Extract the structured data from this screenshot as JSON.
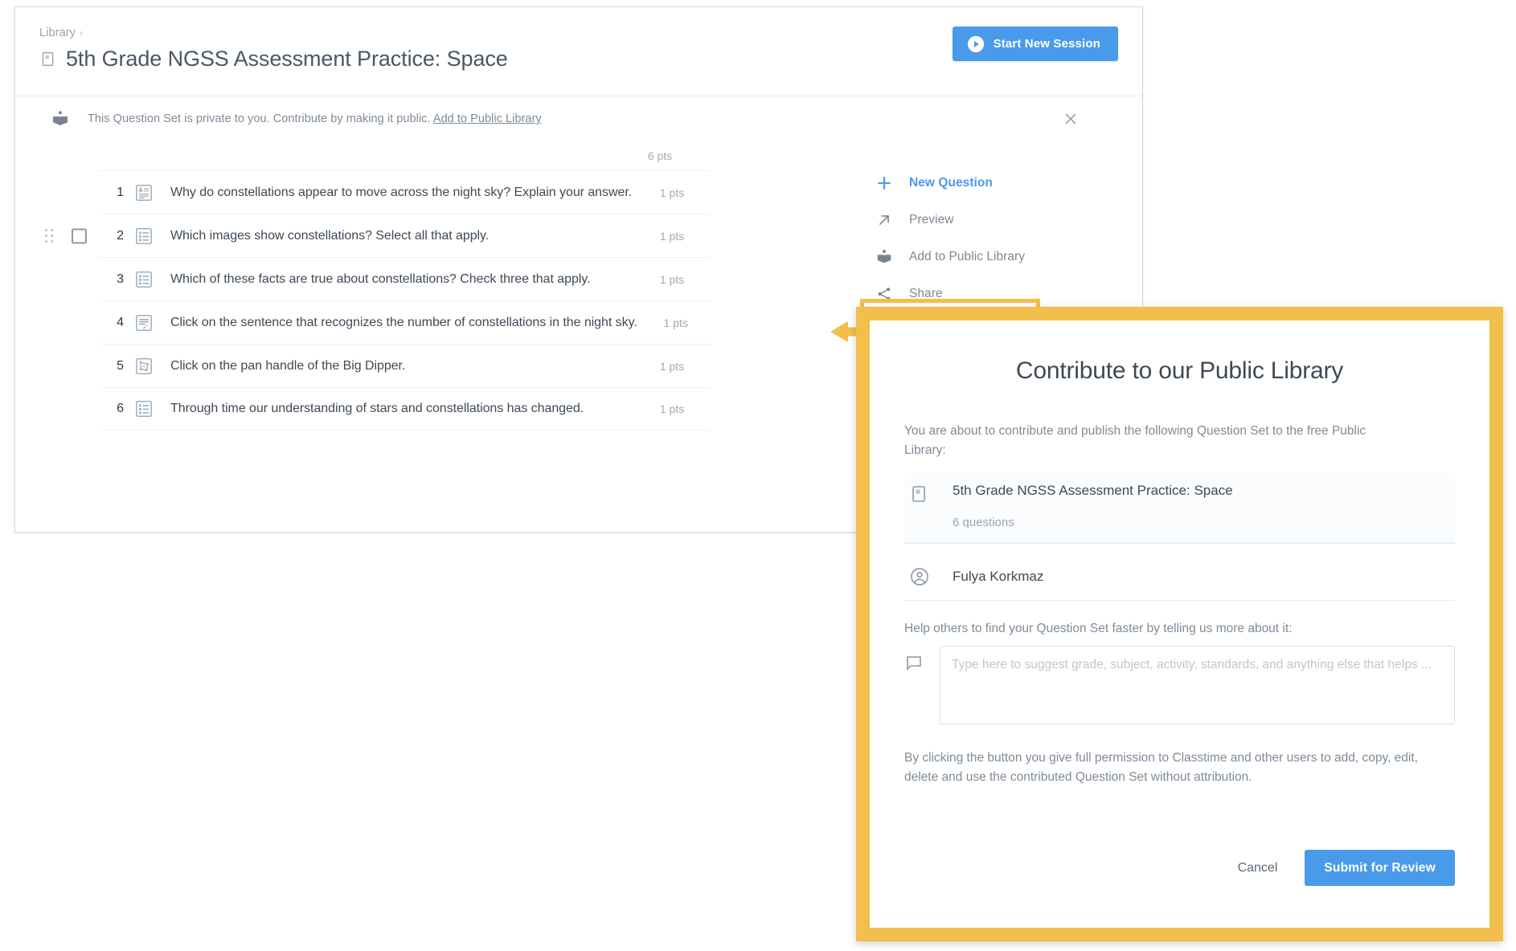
{
  "header": {
    "breadcrumb_label": "Library",
    "breadcrumb_chevron": "›",
    "title": "5th Grade NGSS Assessment Practice: Space",
    "doc_icon": "document-icon",
    "start_session_label": "Start New Session",
    "play_icon": "play-circle-icon",
    "accent_blue": "#4a9aea"
  },
  "banner": {
    "icon": "open-book-icon",
    "text_before": "This Question Set is private to you. Contribute by making it public.",
    "link_label": "Add to Public Library",
    "close_icon": "close-icon"
  },
  "question_list": {
    "points_header": "6 pts",
    "grip_icon": "drag-handle-icon",
    "checkbox_icon": "checkbox-unchecked-icon",
    "rows": [
      {
        "num": "1",
        "icon": "free-text-question-icon",
        "text": "Why do constellations appear to move across the night sky? Explain your answer.",
        "pts": "1 pts",
        "show_controls": false
      },
      {
        "num": "2",
        "icon": "multiple-choice-question-icon",
        "text": "Which images show constellations? Select all that apply.",
        "pts": "1 pts",
        "show_controls": true
      },
      {
        "num": "3",
        "icon": "multiple-choice-question-icon",
        "text": "Which of these facts are true about constellations? Check three that apply.",
        "pts": "1 pts",
        "show_controls": false
      },
      {
        "num": "4",
        "icon": "highlight-text-question-icon",
        "text": "Click on the sentence that recognizes the number of constellations in the night sky.",
        "pts": "1 pts",
        "show_controls": false
      },
      {
        "num": "5",
        "icon": "hotspot-image-question-icon",
        "text": "Click on the pan handle of the Big Dipper.",
        "pts": "1 pts",
        "show_controls": false
      },
      {
        "num": "6",
        "icon": "multiple-choice-question-icon",
        "text": "Through time our understanding of stars and constellations has changed.",
        "pts": "1 pts",
        "show_controls": false
      }
    ]
  },
  "actions_menu": {
    "items": [
      {
        "label": "New Question",
        "icon": "plus-icon",
        "primary": true
      },
      {
        "label": "Preview",
        "icon": "arrow-up-right-icon",
        "primary": false
      },
      {
        "label": "Add to Public Library",
        "icon": "open-book-icon",
        "primary": false
      },
      {
        "label": "Share",
        "icon": "share-icon",
        "primary": false
      }
    ],
    "highlight_color": "#f2bf4c"
  },
  "modal": {
    "title": "Contribute to our Public Library",
    "lead": "You are about to contribute and publish the following Question Set to the free Public Library:",
    "set_icon": "document-icon",
    "set_name": "5th Grade NGSS Assessment Practice: Space",
    "set_count": "6 questions",
    "user_icon": "account-circle-icon",
    "user_name": "Fulya Korkmaz",
    "help_label": "Help others to find your Question Set faster by telling us more about it:",
    "comment_icon": "comment-icon",
    "textarea_value": "",
    "textarea_placeholder": "Type here to suggest grade, subject, activity, standards, and anything else that helps ...",
    "legal": "By clicking the button you give full permission to Classtime and other users to add, copy, edit, delete and use the contributed Question Set without attribution.",
    "cancel_label": "Cancel",
    "submit_label": "Submit for Review",
    "border_color": "#f2bf4c"
  }
}
